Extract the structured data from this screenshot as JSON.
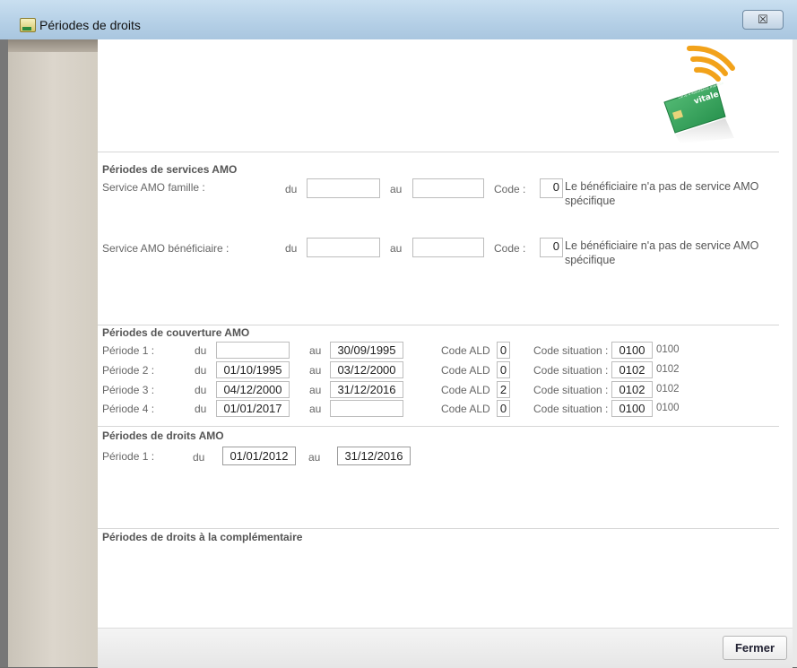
{
  "window": {
    "title": "Périodes de droits",
    "close_label": "☒"
  },
  "services_amo": {
    "title": "Périodes de services AMO",
    "rows": [
      {
        "label": "Service AMO famille :",
        "du_label": "du",
        "du": "",
        "au_label": "au",
        "au": "",
        "code_label": "Code :",
        "code": "0",
        "description": "Le bénéficiaire n'a pas de service AMO spécifique"
      },
      {
        "label": "Service AMO bénéficiaire :",
        "du_label": "du",
        "du": "",
        "au_label": "au",
        "au": "",
        "code_label": "Code :",
        "code": "0",
        "description": "Le bénéficiaire n'a pas de service AMO spécifique"
      }
    ]
  },
  "couverture_amo": {
    "title": "Périodes de couverture AMO",
    "rows": [
      {
        "label": "Période 1 :",
        "du_label": "du",
        "du": "",
        "au_label": "au",
        "au": "30/09/1995",
        "ald_label": "Code ALD",
        "ald": "0",
        "situation_label": "Code situation :",
        "situation": "0100",
        "situation_text": "0100"
      },
      {
        "label": "Période 2 :",
        "du_label": "du",
        "du": "01/10/1995",
        "au_label": "au",
        "au": "03/12/2000",
        "ald_label": "Code ALD",
        "ald": "0",
        "situation_label": "Code situation :",
        "situation": "0102",
        "situation_text": "0102"
      },
      {
        "label": "Période 3 :",
        "du_label": "du",
        "du": "04/12/2000",
        "au_label": "au",
        "au": "31/12/2016",
        "ald_label": "Code ALD",
        "ald": "2",
        "situation_label": "Code situation :",
        "situation": "0102",
        "situation_text": "0102"
      },
      {
        "label": "Période 4 :",
        "du_label": "du",
        "du": "01/01/2017",
        "au_label": "au",
        "au": "",
        "ald_label": "Code ALD",
        "ald": "0",
        "situation_label": "Code situation :",
        "situation": "0100",
        "situation_text": "0100"
      }
    ]
  },
  "droits_amo": {
    "title": "Périodes de droits AMO",
    "rows": [
      {
        "label": "Période 1 :",
        "du_label": "du",
        "du": "01/01/2012",
        "au_label": "au",
        "au": "31/12/2016"
      }
    ]
  },
  "complementaire": {
    "title": "Périodes de droits à la complémentaire"
  },
  "logo": {
    "card_text": "vitale",
    "card_subtext": "carte d'assurance maladie",
    "card_color": "#2e9a55",
    "signal_color": "#f2a21a",
    "icon": "vitale-card-icon"
  },
  "footer": {
    "fermer_label": "Fermer"
  }
}
